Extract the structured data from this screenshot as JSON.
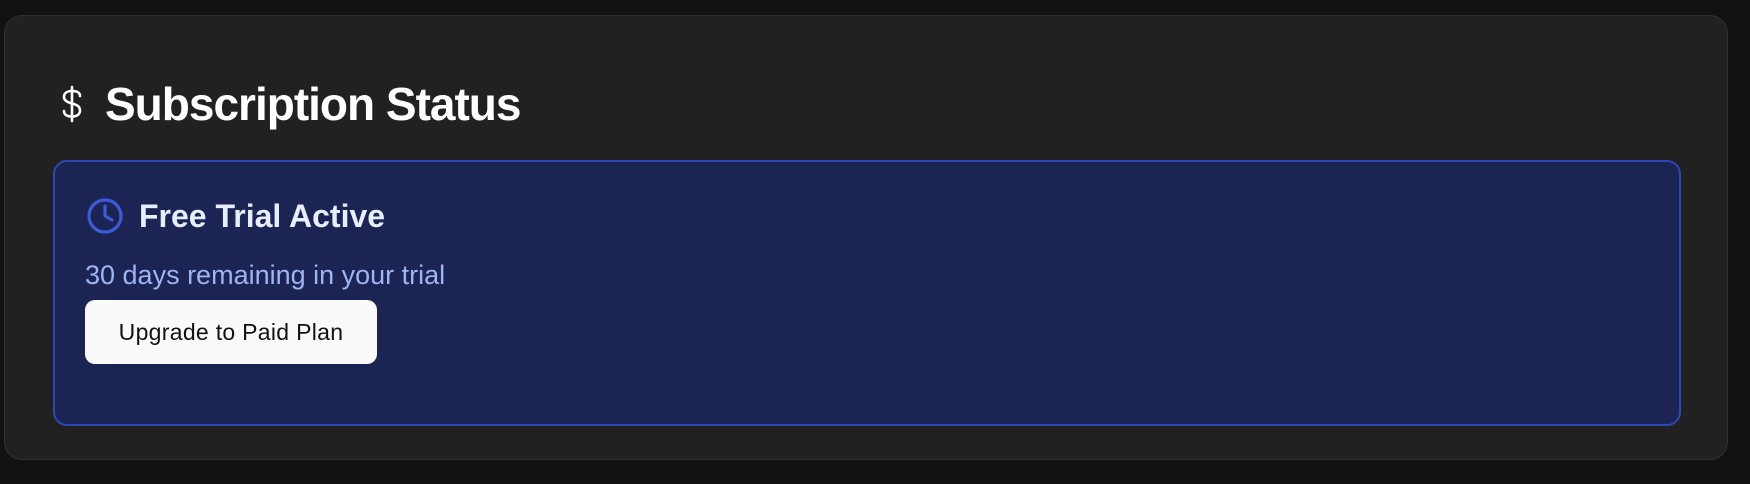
{
  "subscription": {
    "title": "Subscription Status",
    "title_icon": "dollar-icon"
  },
  "trial": {
    "icon": "clock-icon",
    "title": "Free Trial Active",
    "description": "30 days remaining in your trial",
    "upgrade_label": "Upgrade to Paid Plan"
  },
  "colors": {
    "page_background": "#121212",
    "card_background": "#212121",
    "panel_background": "#1b2453",
    "panel_border": "#2c47b7",
    "accent": "#3b5bdb",
    "description_text": "#9db4f5",
    "button_background": "#fafafa"
  }
}
